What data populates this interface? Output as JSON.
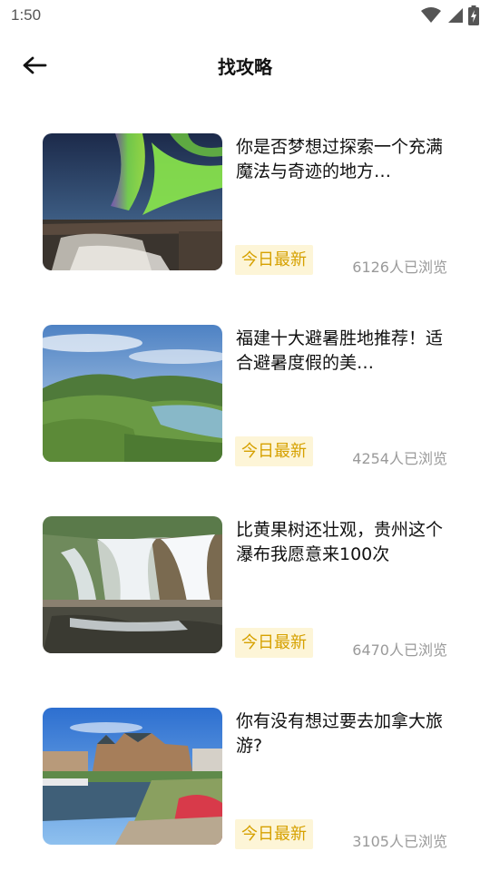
{
  "status_bar": {
    "time": "1:50"
  },
  "app_bar": {
    "title": "找攻略"
  },
  "articles": [
    {
      "title": "你是否梦想过探索一个充满魔法与奇迹的地方…",
      "tag": "今日最新",
      "views": "6126人已浏览",
      "image": "aurora-waterfall"
    },
    {
      "title": "福建十大避暑胜地推荐！适合避暑度假的美…",
      "tag": "今日最新",
      "views": "4254人已浏览",
      "image": "green-mountain-lake"
    },
    {
      "title": "比黄果树还壮观，贵州这个瀑布我愿意来100次",
      "tag": "今日最新",
      "views": "6470人已浏览",
      "image": "waterfall-cliff"
    },
    {
      "title": "你有没有想过要去加拿大旅游?",
      "tag": "今日最新",
      "views": "3105人已浏览",
      "image": "harbor-hotel"
    }
  ]
}
